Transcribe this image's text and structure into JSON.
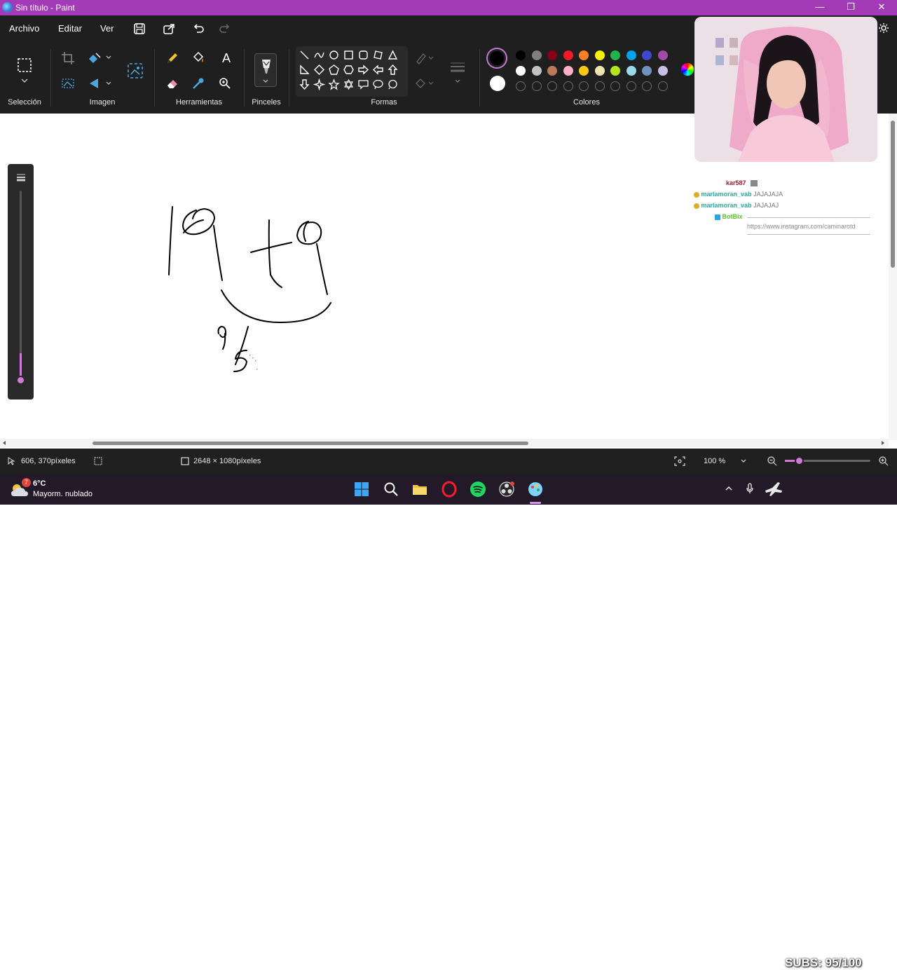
{
  "window": {
    "title": "Sin título - Paint",
    "minimize": "—",
    "maximize": "❐",
    "close": "✕"
  },
  "menu": {
    "file": "Archivo",
    "edit": "Editar",
    "view": "Ver"
  },
  "ribbon": {
    "groups": {
      "selection": "Selección",
      "image": "Imagen",
      "tools": "Herramientas",
      "brushes": "Pinceles",
      "shapes": "Formas",
      "colors": "Colores"
    },
    "text_tool_glyph": "A",
    "palette_row1": [
      "#000000",
      "#7f7f7f",
      "#880015",
      "#ed1c24",
      "#ff7f27",
      "#fff200",
      "#22b14c",
      "#00a2e8",
      "#3f48cc",
      "#a349a4"
    ],
    "palette_row2": [
      "#ffffff",
      "#c3c3c3",
      "#b97a57",
      "#ffaec9",
      "#ffc90e",
      "#efe4b0",
      "#b5e61d",
      "#99d9ea",
      "#7092be",
      "#c8bfe7"
    ],
    "primary_color": "#000000",
    "secondary_color": "#ffffff"
  },
  "chat": {
    "lines": [
      {
        "user": "kar587",
        "user_color": "#9b1b2b",
        "text": ""
      },
      {
        "user": "marlamoran_vab",
        "user_color": "#2ea7a0",
        "text": "JAJAJAJA"
      },
      {
        "user": "marlamoran_vab",
        "user_color": "#2ea7a0",
        "text": "JAJAJAJ"
      },
      {
        "user": "BotBix",
        "user_color": "#5ec02e",
        "text": "https://www.instagram.com/caminarotd"
      }
    ]
  },
  "status": {
    "cursor_position": "606, 370píxeles",
    "canvas_size": "2648 × 1080píxeles",
    "zoom": "100 %"
  },
  "taskbar": {
    "weather_temp": "6°C",
    "weather_desc": "Mayorm. nublado",
    "weather_badge": "7",
    "overlay_subs": "SUBS: 95/100"
  }
}
